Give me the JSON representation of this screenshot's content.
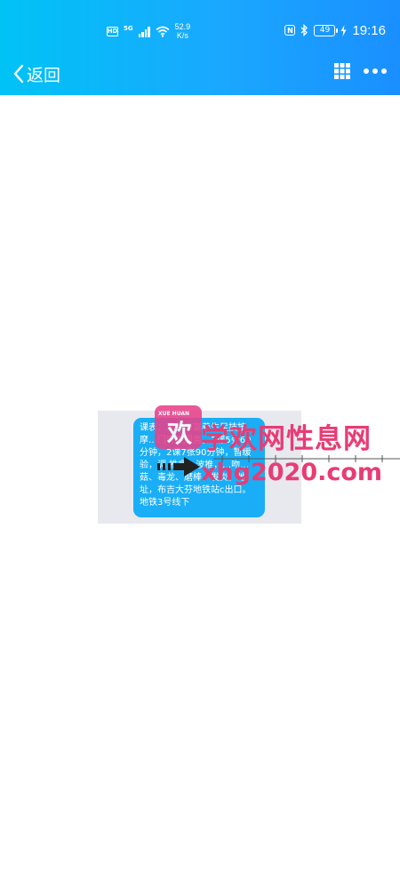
{
  "status_bar": {
    "hd": "HD",
    "network": "5G",
    "speed_value": "52.9",
    "speed_unit": "K/s",
    "nfc": "N",
    "battery": "49",
    "time": "19:16"
  },
  "nav": {
    "back_label": "返回",
    "icons": [
      "back-chevron-icon",
      "grid-icon",
      "more-icon"
    ]
  },
  "message": {
    "text": "课表：享受康富养生足技按摩…门环保服务，1课5张60分钟，2课7张90分钟，暂缓验，调 推拿，波推，…吻…菇、毒龙、磨棒、发炎。地址，布吉大芬地铁站c出口。地铁3号线下"
  },
  "watermark": {
    "logo_small": "XUE HUAN",
    "logo_char": "欢",
    "title": "学欢网性息网",
    "site": "xhg2020.com"
  },
  "colors": {
    "header_start": "#00c3f5",
    "header_end": "#1a8fff",
    "bubble": "#19aef6",
    "watermark": "#e83c75"
  }
}
